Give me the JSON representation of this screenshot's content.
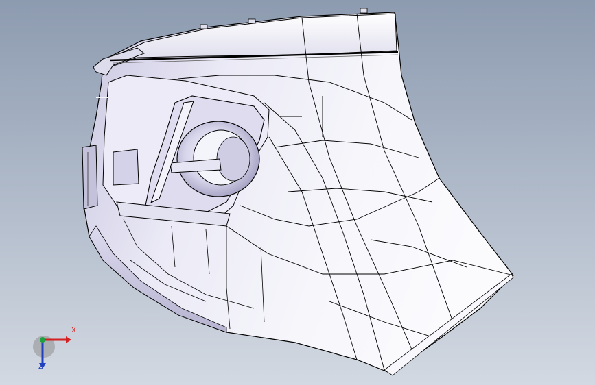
{
  "viewport": {
    "background_top": "#8d9bb0",
    "background_bottom": "#d3d9e2",
    "model_fill": "#ebeaf6",
    "model_shade": "#b8b5d2",
    "edge_color": "#000000"
  },
  "triad": {
    "x_label": "X",
    "z_label": "Z",
    "x_color": "#d32020",
    "y_color": "#20a040",
    "z_color": "#2040c0"
  }
}
